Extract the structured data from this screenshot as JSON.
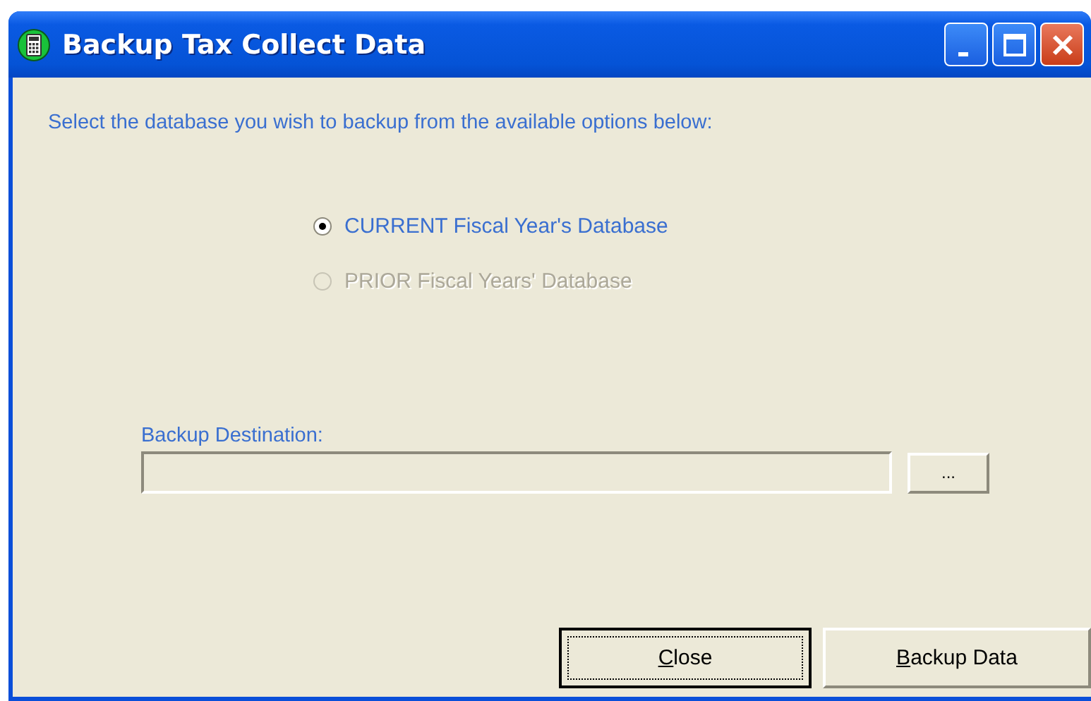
{
  "window": {
    "title": "Backup Tax Collect Data"
  },
  "instruction": "Select the database you wish to backup from the available options below:",
  "options": [
    {
      "label": "CURRENT Fiscal Year's Database",
      "selected": true,
      "disabled": false
    },
    {
      "label": "PRIOR Fiscal Years' Database",
      "selected": false,
      "disabled": true
    }
  ],
  "destination": {
    "label": "Backup Destination:",
    "browse_button": "..."
  },
  "buttons": [
    {
      "access_key": "C",
      "rest": "lose",
      "focused": true
    },
    {
      "access_key": "B",
      "rest": "ackup Data",
      "focused": false
    }
  ]
}
